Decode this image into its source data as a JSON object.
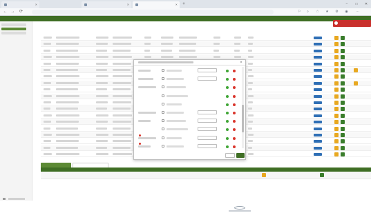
{
  "browser": {
    "tabs": [
      {
        "label": "",
        "active": false
      },
      {
        "label": "",
        "active": false
      },
      {
        "label": "",
        "active": true
      }
    ],
    "new_tab_symbol": "+",
    "window_controls": {
      "minimize": "−",
      "maximize": "□",
      "close": "✕"
    },
    "url": "",
    "nav": {
      "back": "←",
      "forward": "→",
      "reload": "⟳"
    }
  },
  "sidebar": {
    "items": [
      {
        "label": "",
        "active": false
      },
      {
        "label": "",
        "active": true
      },
      {
        "label": "",
        "active": false
      }
    ]
  },
  "alert": {
    "text": ""
  },
  "table": {
    "row_count": 19,
    "row_action_sets": [
      [
        "yellow",
        "green"
      ],
      [
        "yellow",
        "green"
      ],
      [
        "yellow",
        "green"
      ],
      [
        "yellow",
        "green"
      ],
      [
        "yellow",
        "green"
      ],
      [
        "yellow",
        "green",
        "orange"
      ],
      [
        "yellow",
        "green"
      ],
      [
        "yellow",
        "green",
        "orange"
      ],
      [
        "yellow",
        "green"
      ],
      [
        "yellow",
        "green"
      ],
      [
        "yellow",
        "green"
      ],
      [
        "yellow",
        "green"
      ],
      [
        "yellow",
        "green"
      ],
      [
        "yellow",
        "green"
      ],
      [
        "yellow",
        "green"
      ],
      [
        "yellow",
        "green"
      ],
      [
        "yellow",
        "green"
      ],
      [
        "yellow",
        "green"
      ],
      [
        "yellow",
        "green"
      ]
    ]
  },
  "modal": {
    "title": "",
    "rows": [
      {
        "label": "",
        "value": ""
      },
      {
        "label": "",
        "value": ""
      },
      {
        "label": "",
        "value": ""
      },
      {
        "label": "",
        "value": ""
      },
      {
        "label": "",
        "value": ""
      },
      {
        "label": "",
        "value": ""
      },
      {
        "label": "",
        "value": ""
      },
      {
        "label": "",
        "value": ""
      },
      {
        "label": "",
        "value": ""
      },
      {
        "label": "",
        "value": ""
      }
    ],
    "cancel_label": "",
    "ok_label": ""
  },
  "subtabs": [
    {
      "label": ""
    },
    {
      "label": ""
    }
  ],
  "subtable": {
    "row": {
      "col1": "",
      "col2": ""
    }
  },
  "colors": {
    "brand_green": "#3f6e24",
    "accent_green": "#5c8a35",
    "action_yellow": "#e8a820",
    "action_green": "#3a7d2c",
    "badge_blue": "#2f6fb5",
    "alert_red": "#c9302c"
  },
  "icons": [
    "favicon-icon",
    "close-icon",
    "plus-icon",
    "back-arrow-icon",
    "forward-arrow-icon",
    "reload-icon",
    "star-icon",
    "settings-icon",
    "profile-icon",
    "alert-icon",
    "status-dot-icon",
    "flag-icon"
  ]
}
